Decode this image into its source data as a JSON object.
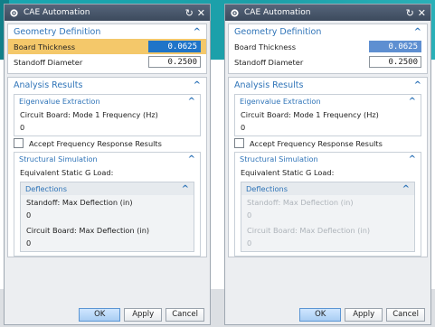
{
  "window": {
    "title": "CAE Automation"
  },
  "geometry": {
    "title": "Geometry Definition",
    "board_thickness_label": "Board Thickness",
    "board_thickness_value": "0.0625",
    "standoff_diameter_label": "Standoff Diameter",
    "standoff_diameter_value": "0.2500"
  },
  "analysis": {
    "title": "Analysis Results",
    "eigenvalue": {
      "title": "Eigenvalue Extraction",
      "freq_label": "Circuit Board: Mode 1 Frequency (Hz)",
      "freq_value": "0"
    },
    "accept_label": "Accept Frequency Response Results",
    "structural": {
      "title": "Structural Simulation",
      "gload_label": "Equivalent Static G Load:",
      "deflections": {
        "title": "Deflections",
        "standoff_label": "Standoff: Max Deflection (in)",
        "standoff_value": "0",
        "board_label": "Circuit Board: Max Deflection (in)",
        "board_value": "0"
      }
    }
  },
  "buttons": {
    "ok": "OK",
    "apply": "Apply",
    "cancel": "Cancel"
  }
}
